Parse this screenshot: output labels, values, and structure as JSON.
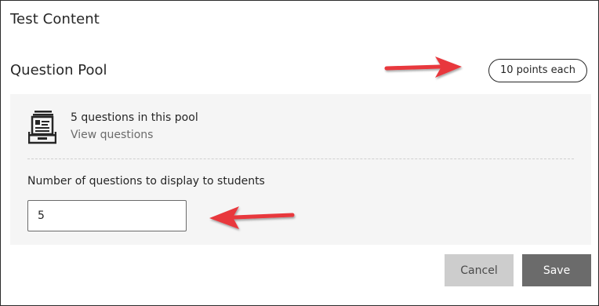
{
  "header": {
    "title": "Test Content"
  },
  "question_pool": {
    "title": "Question Pool",
    "points_label": "10 points each",
    "pool_count_text": "5 questions in this pool",
    "view_link": "View questions",
    "display_field": {
      "label": "Number of questions to display to students",
      "value": "5"
    }
  },
  "actions": {
    "cancel_label": "Cancel",
    "save_label": "Save"
  },
  "colors": {
    "annotation_arrow": "#e8383d",
    "panel_bg": "#f5f5f5",
    "save_bg": "#6b6b6b",
    "cancel_bg": "#cdcdcd"
  },
  "icons": {
    "pool": "question-pool-icon",
    "arrow": "annotation-arrow-icon"
  }
}
